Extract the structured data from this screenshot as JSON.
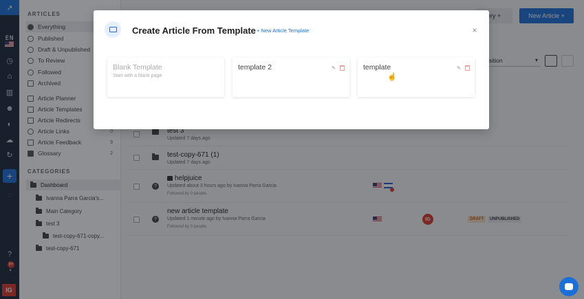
{
  "rail": {
    "lang_code": "EN",
    "badge": "9+",
    "user_initials": "IG",
    "add_label": "+"
  },
  "sidebar": {
    "articles_heading": "ARTICLES",
    "items": [
      {
        "label": "Everything",
        "count": ""
      },
      {
        "label": "Published",
        "count": ""
      },
      {
        "label": "Draft & Unpublished",
        "count": ""
      },
      {
        "label": "To Review",
        "count": ""
      },
      {
        "label": "Followed",
        "count": ""
      },
      {
        "label": "Archived",
        "count": ""
      },
      {
        "label": "Article Planner",
        "count": ""
      },
      {
        "label": "Article Templates",
        "count": ""
      },
      {
        "label": "Article Redirects",
        "count": ""
      },
      {
        "label": "Article Links",
        "count": "0"
      },
      {
        "label": "Article Feedback",
        "count": "9"
      },
      {
        "label": "Glossary",
        "count": "2"
      }
    ],
    "categories_heading": "CATEGORIES",
    "categories": [
      {
        "label": "Dashboard"
      },
      {
        "label": "Ivanna Parra Garcia's..."
      },
      {
        "label": "Main Category"
      },
      {
        "label": "test 3"
      },
      {
        "label": "test-copy-671-copy..."
      },
      {
        "label": "test-copy-671"
      }
    ]
  },
  "main": {
    "category_button": "ory +",
    "new_article_button": "New Article +",
    "sort_select": "osition",
    "rows": [
      {
        "title": "test 3",
        "updated": "Updated 7 days ago",
        "followed": ""
      },
      {
        "title": "test-copy-671 (1)",
        "updated": "Updated 7 days ago",
        "followed": ""
      },
      {
        "title": "helpjuice",
        "updated": "Updated about 3 hours ago by Ivanna Parra Garcia",
        "followed": "Followed by 0 people."
      },
      {
        "title": "new article template",
        "updated": "Updated 1 minute ago by Ivanna Parra Garcia",
        "followed": "Followed by 0 people.",
        "author_initials": "IG",
        "badge_draft": "DRAFT",
        "badge_unpublished": "UNPUBLISHED"
      }
    ]
  },
  "modal": {
    "title": "Create Article From Template",
    "new_template_link": "+ New Article Template",
    "close": "×",
    "templates": [
      {
        "title": "Blank Template",
        "subtitle": "Start with a blank page"
      },
      {
        "title": "template 2",
        "subtitle": ""
      },
      {
        "title": "template",
        "subtitle": ""
      }
    ]
  }
}
